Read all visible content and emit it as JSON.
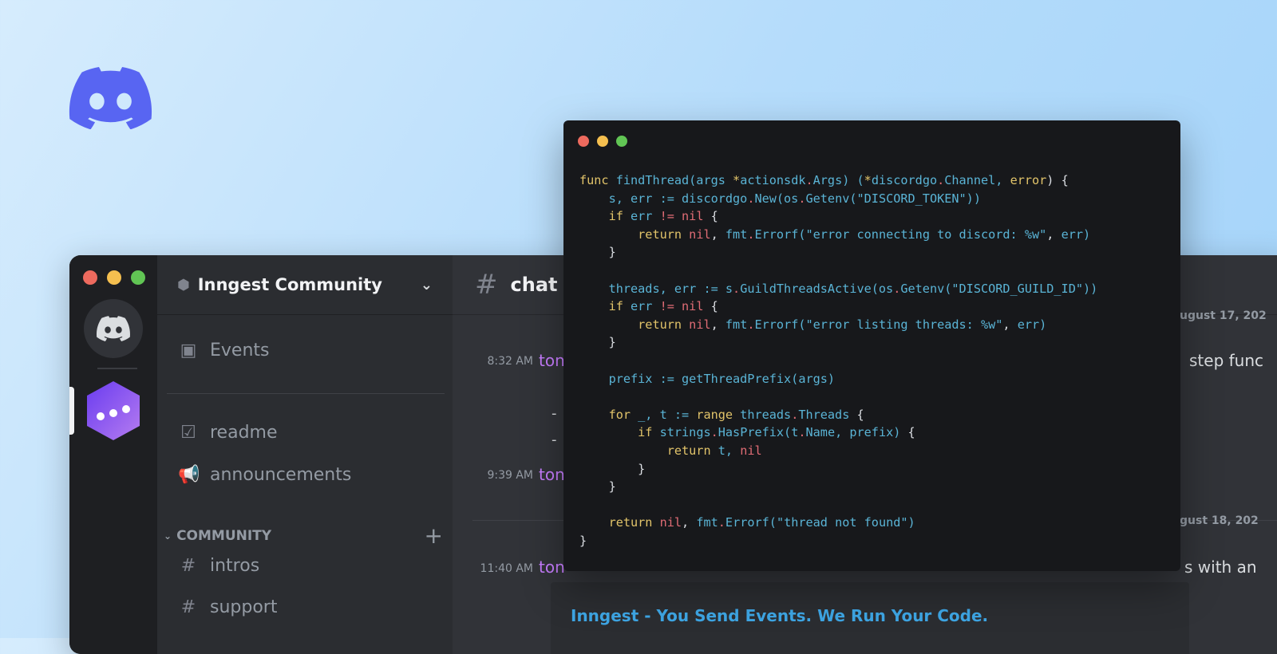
{
  "colors": {
    "background": "#b5dcfb",
    "discord_blurple": "#5865f2",
    "username": "#c77dff",
    "link": "#3ea6e5"
  },
  "server": {
    "name": "Inngest Community"
  },
  "sidebar": {
    "items": [
      {
        "label": "Events",
        "icon": "calendar-icon"
      },
      {
        "label": "readme",
        "icon": "checklist-icon"
      },
      {
        "label": "announcements",
        "icon": "megaphone-icon"
      }
    ],
    "category": "COMMUNITY",
    "channels": [
      {
        "label": "intros",
        "icon": "hash-icon"
      },
      {
        "label": "support",
        "icon": "forum-icon"
      }
    ]
  },
  "channel": {
    "name": "chat"
  },
  "messages": [
    {
      "time": "8:32 AM",
      "author": "ton",
      "text": "step func"
    },
    {
      "time": "9:39 AM",
      "author": "ton"
    },
    {
      "time": "11:40 AM",
      "author": "ton",
      "text": "s with an"
    }
  ],
  "dates": [
    "ugust 17, 202",
    "gust 18, 202"
  ],
  "bullets": [
    "-",
    "-"
  ],
  "embed": {
    "title": "Inngest - You Send Events. We Run Your Code."
  },
  "code": [
    [
      [
        "kw",
        "func"
      ],
      [
        "id",
        " findThread(args "
      ],
      [
        "kw",
        "*"
      ],
      [
        "id",
        "actionsdk"
      ],
      [
        "rd",
        "."
      ],
      [
        "id",
        "Args) ("
      ],
      [
        "kw",
        "*"
      ],
      [
        "id",
        "discordgo"
      ],
      [
        "rd",
        "."
      ],
      [
        "id",
        "Channel, "
      ],
      [
        "kw",
        "error"
      ],
      [
        "pl",
        ") {"
      ]
    ],
    [
      [
        "pl",
        "    "
      ],
      [
        "id",
        "s, err := discordgo"
      ],
      [
        "rd",
        "."
      ],
      [
        "id",
        "New(os"
      ],
      [
        "rd",
        "."
      ],
      [
        "id",
        "Getenv("
      ],
      [
        "st",
        "\"DISCORD_TOKEN\""
      ],
      [
        "id",
        "))"
      ]
    ],
    [
      [
        "pl",
        "    "
      ],
      [
        "kw",
        "if"
      ],
      [
        "id",
        " err "
      ],
      [
        "rd",
        "!="
      ],
      [
        "rd",
        " nil"
      ],
      [
        "pl",
        " {"
      ]
    ],
    [
      [
        "pl",
        "        "
      ],
      [
        "kw",
        "return"
      ],
      [
        "rd",
        " nil"
      ],
      [
        "pl",
        ", "
      ],
      [
        "id",
        "fmt"
      ],
      [
        "rd",
        "."
      ],
      [
        "id",
        "Errorf("
      ],
      [
        "st",
        "\"error connecting to discord: %w\""
      ],
      [
        "pl",
        ", "
      ],
      [
        "id",
        "err)"
      ]
    ],
    [
      [
        "pl",
        "    }"
      ]
    ],
    [
      [
        "pl",
        ""
      ]
    ],
    [
      [
        "pl",
        "    "
      ],
      [
        "id",
        "threads, err := s"
      ],
      [
        "rd",
        "."
      ],
      [
        "id",
        "GuildThreadsActive(os"
      ],
      [
        "rd",
        "."
      ],
      [
        "id",
        "Getenv("
      ],
      [
        "st",
        "\"DISCORD_GUILD_ID\""
      ],
      [
        "id",
        "))"
      ]
    ],
    [
      [
        "pl",
        "    "
      ],
      [
        "kw",
        "if"
      ],
      [
        "id",
        " err "
      ],
      [
        "rd",
        "!="
      ],
      [
        "rd",
        " nil"
      ],
      [
        "pl",
        " {"
      ]
    ],
    [
      [
        "pl",
        "        "
      ],
      [
        "kw",
        "return"
      ],
      [
        "rd",
        " nil"
      ],
      [
        "pl",
        ", "
      ],
      [
        "id",
        "fmt"
      ],
      [
        "rd",
        "."
      ],
      [
        "id",
        "Errorf("
      ],
      [
        "st",
        "\"error listing threads: %w\""
      ],
      [
        "pl",
        ", "
      ],
      [
        "id",
        "err)"
      ]
    ],
    [
      [
        "pl",
        "    }"
      ]
    ],
    [
      [
        "pl",
        ""
      ]
    ],
    [
      [
        "pl",
        "    "
      ],
      [
        "id",
        "prefix := getThreadPrefix(args)"
      ]
    ],
    [
      [
        "pl",
        ""
      ]
    ],
    [
      [
        "pl",
        "    "
      ],
      [
        "kw",
        "for"
      ],
      [
        "id",
        " _, t := "
      ],
      [
        "kw",
        "range"
      ],
      [
        "id",
        " threads"
      ],
      [
        "rd",
        "."
      ],
      [
        "id",
        "Threads"
      ],
      [
        "pl",
        " {"
      ]
    ],
    [
      [
        "pl",
        "        "
      ],
      [
        "kw",
        "if"
      ],
      [
        "id",
        " strings"
      ],
      [
        "rd",
        "."
      ],
      [
        "id",
        "HasPrefix(t"
      ],
      [
        "rd",
        "."
      ],
      [
        "id",
        "Name, prefix)"
      ],
      [
        "pl",
        " {"
      ]
    ],
    [
      [
        "pl",
        "            "
      ],
      [
        "kw",
        "return"
      ],
      [
        "id",
        " t, "
      ],
      [
        "rd",
        "nil"
      ]
    ],
    [
      [
        "pl",
        "        }"
      ]
    ],
    [
      [
        "pl",
        "    }"
      ]
    ],
    [
      [
        "pl",
        ""
      ]
    ],
    [
      [
        "pl",
        "    "
      ],
      [
        "kw",
        "return"
      ],
      [
        "rd",
        " nil"
      ],
      [
        "pl",
        ", "
      ],
      [
        "id",
        "fmt"
      ],
      [
        "rd",
        "."
      ],
      [
        "id",
        "Errorf("
      ],
      [
        "st",
        "\"thread not found\""
      ],
      [
        "id",
        ")"
      ]
    ],
    [
      [
        "pl",
        "}"
      ]
    ]
  ]
}
